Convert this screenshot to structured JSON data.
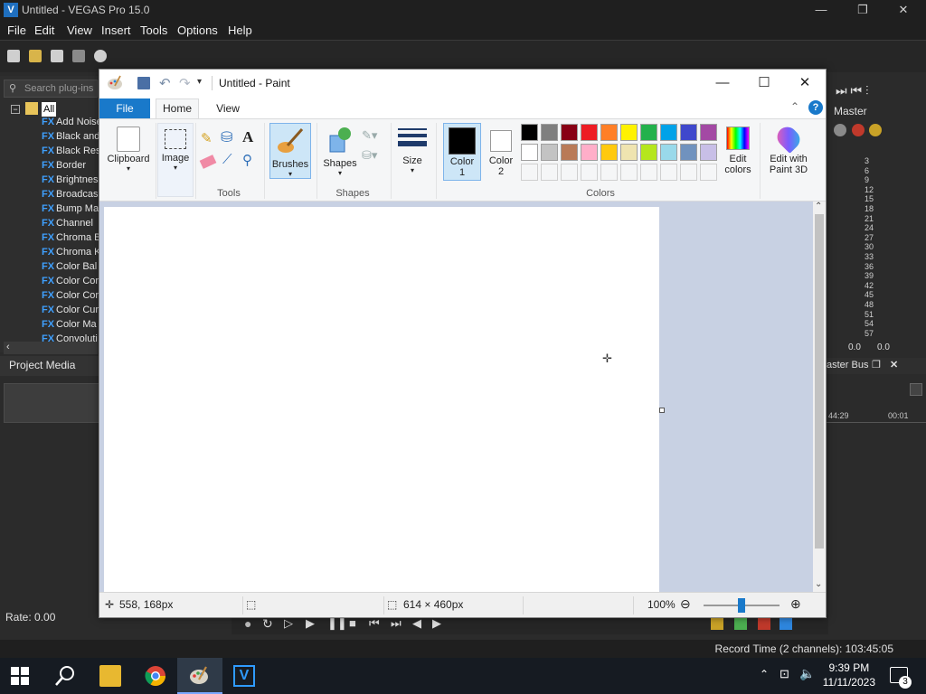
{
  "vegas": {
    "title": "Untitled - VEGAS Pro 15.0",
    "menu": [
      "File",
      "Edit",
      "View",
      "Insert",
      "Tools",
      "Options",
      "Help"
    ],
    "search_placeholder": "Search plug-ins",
    "tree_root": "All",
    "fx_items": [
      "Add Noise",
      "Black and",
      "Black Res",
      "Border",
      "Brightnes",
      "Broadcas",
      "Bump Ma",
      "Channel",
      "Chroma B",
      "Chroma K",
      "Color Bal",
      "Color Cor",
      "Color Cor",
      "Color Cur",
      "Color Ma",
      "Convoluti"
    ],
    "fx_badge": "FX",
    "project_media": "Project Media",
    "rate": "Rate: 0.00",
    "master": "Master",
    "meter_labels": [
      "3",
      "6",
      "9",
      "12",
      "15",
      "18",
      "21",
      "24",
      "27",
      "30",
      "33",
      "36",
      "39",
      "42",
      "45",
      "48",
      "51",
      "54",
      "57"
    ],
    "meter_values": [
      "0.0",
      "0.0"
    ],
    "master_bus": "aster Bus",
    "timeline_ticks": [
      "44:29",
      "00:01"
    ],
    "record_time": "Record Time (2 channels): 103:45:05"
  },
  "taskbar": {
    "time": "9:39 PM",
    "date": "11/11/2023",
    "notification_count": "3"
  },
  "paint": {
    "title": "Untitled - Paint",
    "tabs": {
      "file": "File",
      "home": "Home",
      "view": "View"
    },
    "ribbon": {
      "clipboard": "Clipboard",
      "image": "Image",
      "tools_group": "Tools",
      "brushes": "Brushes",
      "shapes": "Shapes",
      "shapes_group": "Shapes",
      "size": "Size",
      "color1": [
        "Color",
        "1"
      ],
      "color2": [
        "Color",
        "2"
      ],
      "colors_group": "Colors",
      "edit_colors": [
        "Edit",
        "colors"
      ],
      "edit_3d": [
        "Edit with",
        "Paint 3D"
      ]
    },
    "palette_row1": [
      "#000000",
      "#7f7f7f",
      "#880015",
      "#ed1c24",
      "#ff7f27",
      "#fff200",
      "#22b14c",
      "#00a2e8",
      "#3f48cc",
      "#a349a4"
    ],
    "palette_row2": [
      "#ffffff",
      "#c3c3c3",
      "#b97a57",
      "#ffaec9",
      "#ffc90e",
      "#efe4b0",
      "#b5e61d",
      "#99d9ea",
      "#7092be",
      "#c8bfe7"
    ],
    "color1_value": "#000000",
    "color2_value": "#ffffff",
    "status": {
      "cursor_pos": "558, 168px",
      "canvas_size": "614 × 460px",
      "zoom": "100%"
    }
  }
}
